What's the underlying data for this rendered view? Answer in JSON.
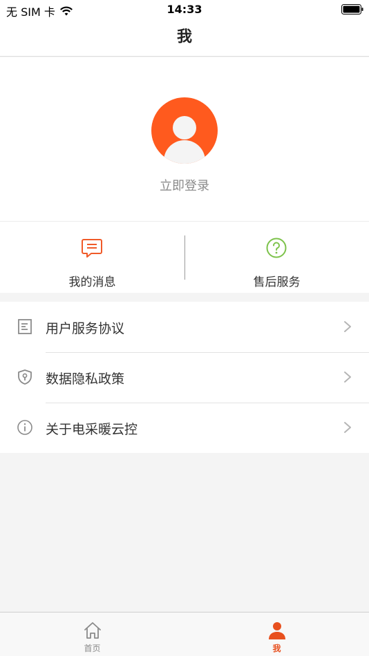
{
  "status_bar": {
    "carrier": "无 SIM 卡",
    "time": "14:33"
  },
  "nav": {
    "title": "我"
  },
  "profile": {
    "login_label": "立即登录",
    "avatar_color": "#ff5a1e"
  },
  "quick_actions": [
    {
      "label": "我的消息",
      "icon": "message-icon",
      "color": "#f05a28"
    },
    {
      "label": "售后服务",
      "icon": "help-icon",
      "color": "#7cc24a"
    }
  ],
  "menu": [
    {
      "label": "用户服务协议",
      "icon": "document-icon"
    },
    {
      "label": "数据隐私政策",
      "icon": "shield-lock-icon"
    },
    {
      "label": "关于电采暖云控",
      "icon": "info-icon"
    }
  ],
  "tab_bar": {
    "items": [
      {
        "label": "首页",
        "icon": "home-icon",
        "active": false
      },
      {
        "label": "我",
        "icon": "person-icon",
        "active": true
      }
    ],
    "active_color": "#e8501e",
    "inactive_color": "#8a8a8a"
  }
}
